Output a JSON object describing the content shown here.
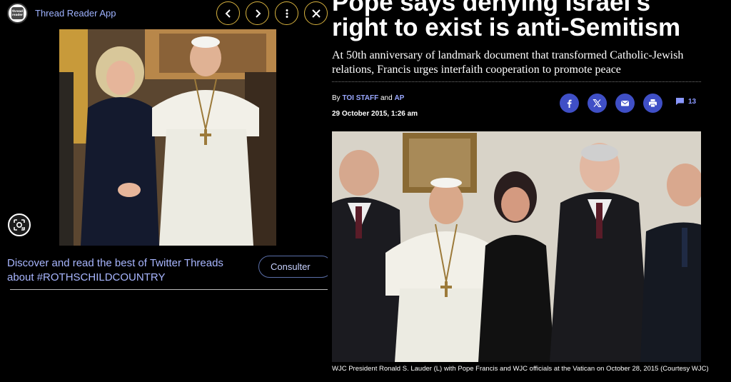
{
  "app": {
    "name": "Thread Reader App",
    "logo_text": "thread reader"
  },
  "promo": {
    "text": "Discover and read the best of Twitter Threads about #ROTHSCHILDCOUNTRY",
    "button_label": "Consulter"
  },
  "nav": {
    "icons": [
      "chevron-left-icon",
      "chevron-right-icon",
      "more-vertical-icon",
      "close-icon"
    ]
  },
  "article": {
    "headline_top": "Pope says denying Israel's",
    "headline": "right to exist is anti-Semitism",
    "subhead": "At 50th anniversary of landmark document that transformed Catholic-Jewish relations, Francis urges interfaith cooperation to promote peace",
    "by_prefix": "By",
    "author1": "TOI STAFF",
    "and_word": "and",
    "author2": "AP",
    "date": "29 October 2015, 1:26 am",
    "comment_count": "13",
    "share_icons": [
      "facebook-icon",
      "x-icon",
      "email-icon",
      "print-icon"
    ],
    "caption": "WJC President Ronald S. Lauder (L) with Pope Francis and WJC officials at the Vatican on October 28, 2015 (Courtesy WJC)"
  },
  "colors": {
    "accent_gold": "#d7b23e",
    "share_blue": "#3f4fc6",
    "link_blue": "#9eb2ff"
  }
}
